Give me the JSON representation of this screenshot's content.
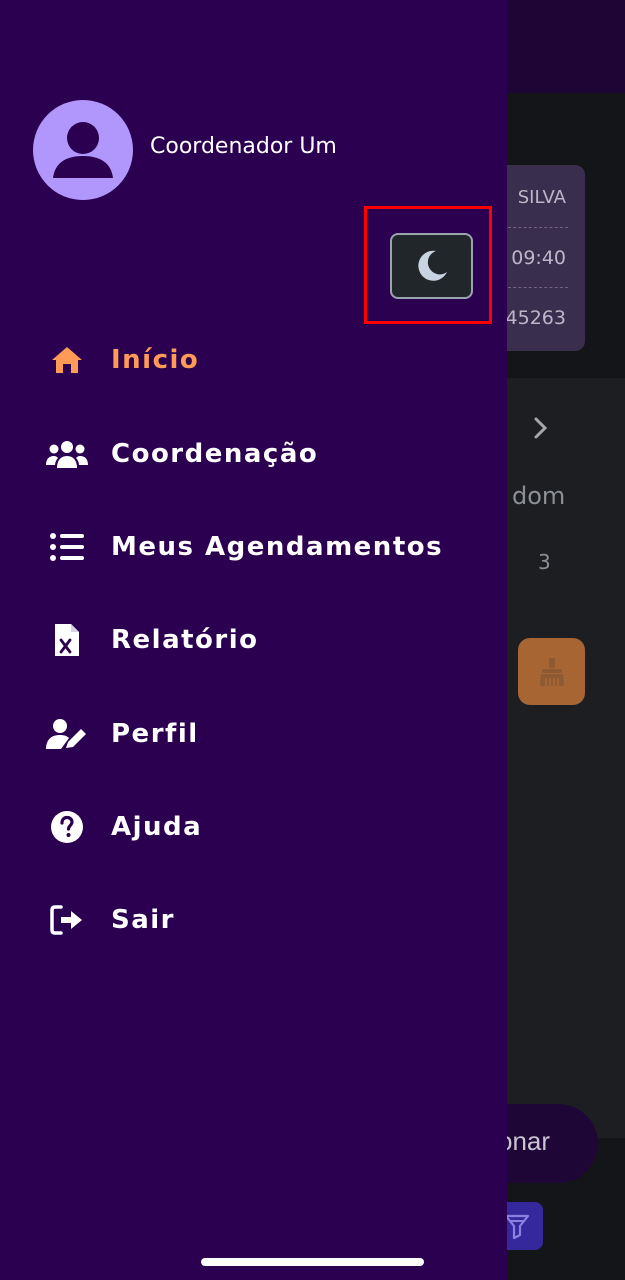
{
  "background": {
    "card": {
      "name": "SILVA",
      "time": "09:40",
      "code": "45263"
    },
    "calendar": {
      "weekday": "dom",
      "day": "3"
    },
    "action_button_text": "onar"
  },
  "drawer": {
    "user": {
      "name": "Coordenador Um"
    },
    "theme_toggle": {
      "icon": "moon-icon"
    },
    "menu": [
      {
        "label": "Início",
        "icon": "home-icon",
        "active": true
      },
      {
        "label": "Coordenação",
        "icon": "users-icon"
      },
      {
        "label": "Meus Agendamentos",
        "icon": "list-icon"
      },
      {
        "label": "Relatório",
        "icon": "excel-file-icon"
      },
      {
        "label": "Perfil",
        "icon": "user-edit-icon"
      },
      {
        "label": "Ajuda",
        "icon": "help-icon"
      },
      {
        "label": "Sair",
        "icon": "logout-icon"
      }
    ],
    "colors": {
      "background": "#2c0050",
      "active": "#ff9a57",
      "text": "#ffffff",
      "highlight": "#ff0000"
    }
  }
}
